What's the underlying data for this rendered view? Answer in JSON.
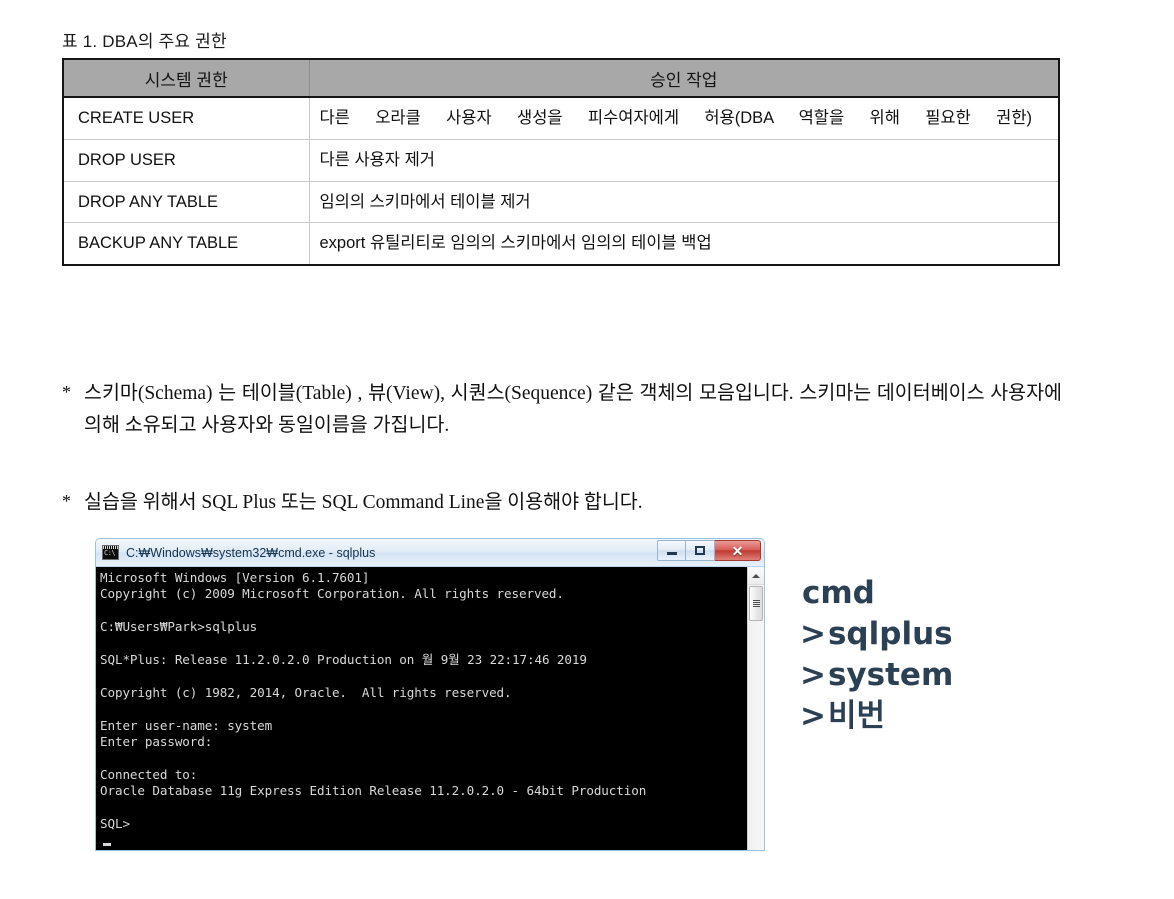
{
  "table": {
    "caption": "표 1. DBA의 주요 권한",
    "headers": [
      "시스템 권한",
      "승인 작업"
    ],
    "rows": [
      {
        "privilege": "CREATE USER",
        "description": "다른 오라클 사용자 생성을 피수여자에게 허용(DBA 역할을 위해 필요한 권한)",
        "justified": true
      },
      {
        "privilege": "DROP USER",
        "description": "다른 사용자 제거",
        "justified": false
      },
      {
        "privilege": "DROP ANY TABLE",
        "description": "임의의 스키마에서 테이블 제거",
        "justified": false
      },
      {
        "privilege": "BACKUP    ANY TABLE",
        "description": "export 유틸리티로 임의의 스키마에서 임의의 테이블 백업",
        "justified": false
      }
    ],
    "header_bg": "#a8a8a8",
    "border_color": "#151515"
  },
  "notes": [
    {
      "marker": "*",
      "text": "스키마(Schema) 는 테이블(Table) , 뷰(View), 시퀀스(Sequence) 같은 객체의 모음입니다. 스키마는 데이터베이스 사용자에 의해 소유되고 사용자와 동일이름을 가집니다."
    },
    {
      "marker": "*",
      "text": "실습을 위해서 SQL Plus 또는 SQL Command Line을 이용해야 합니다."
    }
  ],
  "console": {
    "title": "C:₩Windows₩system32₩cmd.exe - sqlplus",
    "icon": "cmd-icon",
    "buttons": {
      "minimize": "minimize-button",
      "maximize": "maximize-button",
      "close": "✕"
    },
    "output": "Microsoft Windows [Version 6.1.7601]\nCopyright (c) 2009 Microsoft Corporation. All rights reserved.\n\nC:₩Users₩Park>sqlplus\n\nSQL*Plus: Release 11.2.0.2.0 Production on 월 9월 23 22:17:46 2019\n\nCopyright (c) 1982, 2014, Oracle.  All rights reserved.\n\nEnter user-name: system\nEnter password:\n\nConnected to:\nOracle Database 11g Express Edition Release 11.2.0.2.0 - 64bit Production\n\nSQL>",
    "background": "#000000",
    "foreground": "#d8d8d8"
  },
  "annotation": {
    "color": "#2b4052",
    "lines": [
      {
        "arrow": "",
        "text": "cmd"
      },
      {
        "arrow": ">",
        "text": "sqlplus"
      },
      {
        "arrow": ">",
        "text": "system"
      },
      {
        "arrow": ">",
        "text": "비번"
      }
    ]
  }
}
